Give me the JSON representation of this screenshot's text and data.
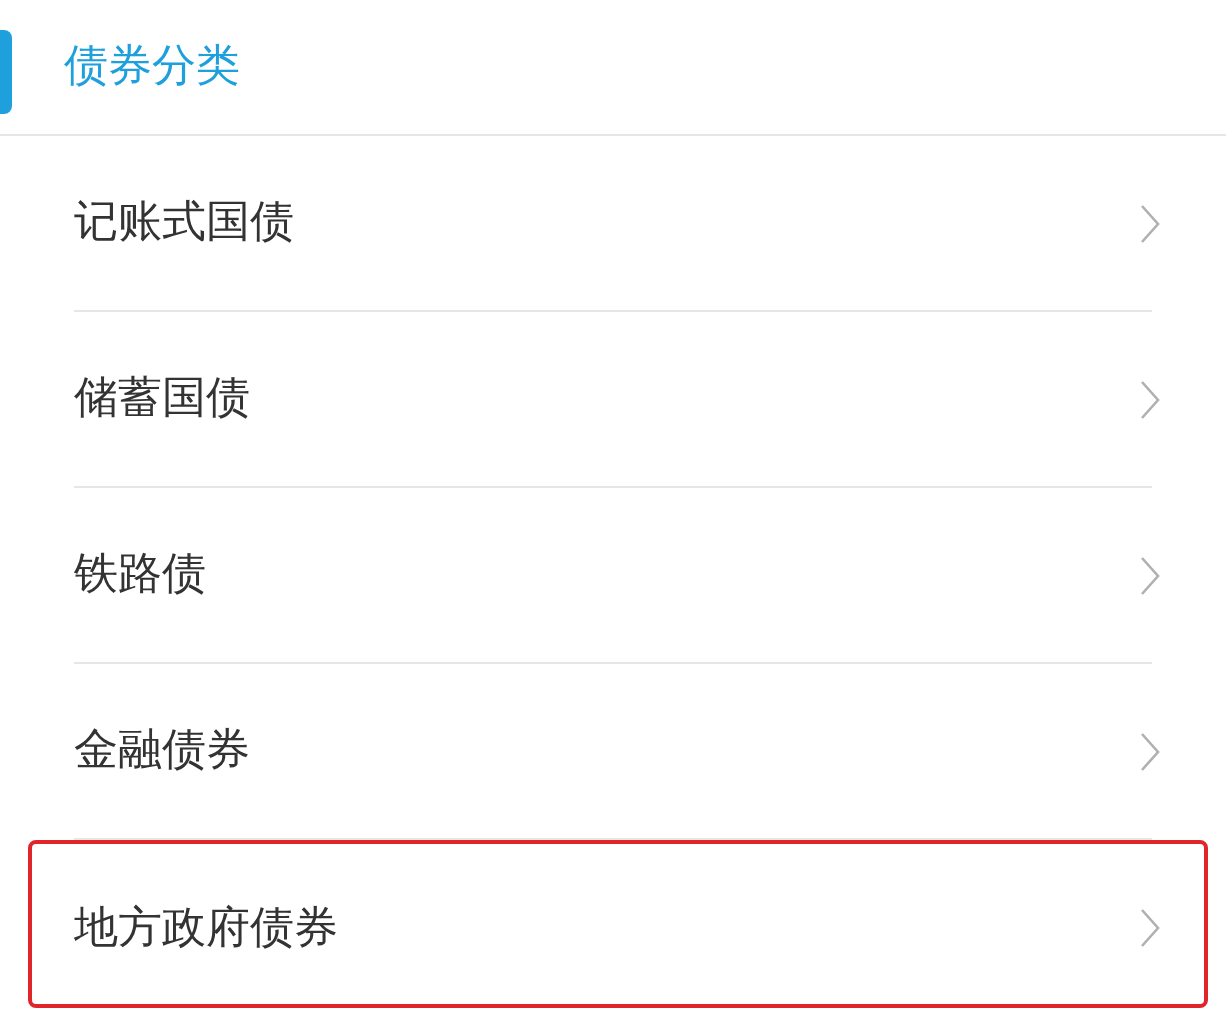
{
  "header": {
    "title": "债券分类"
  },
  "items": [
    {
      "label": "记账式国债",
      "highlighted": false
    },
    {
      "label": "储蓄国债",
      "highlighted": false
    },
    {
      "label": "铁路债",
      "highlighted": false
    },
    {
      "label": "金融债券",
      "highlighted": false
    },
    {
      "label": "地方政府债券",
      "highlighted": true
    }
  ]
}
